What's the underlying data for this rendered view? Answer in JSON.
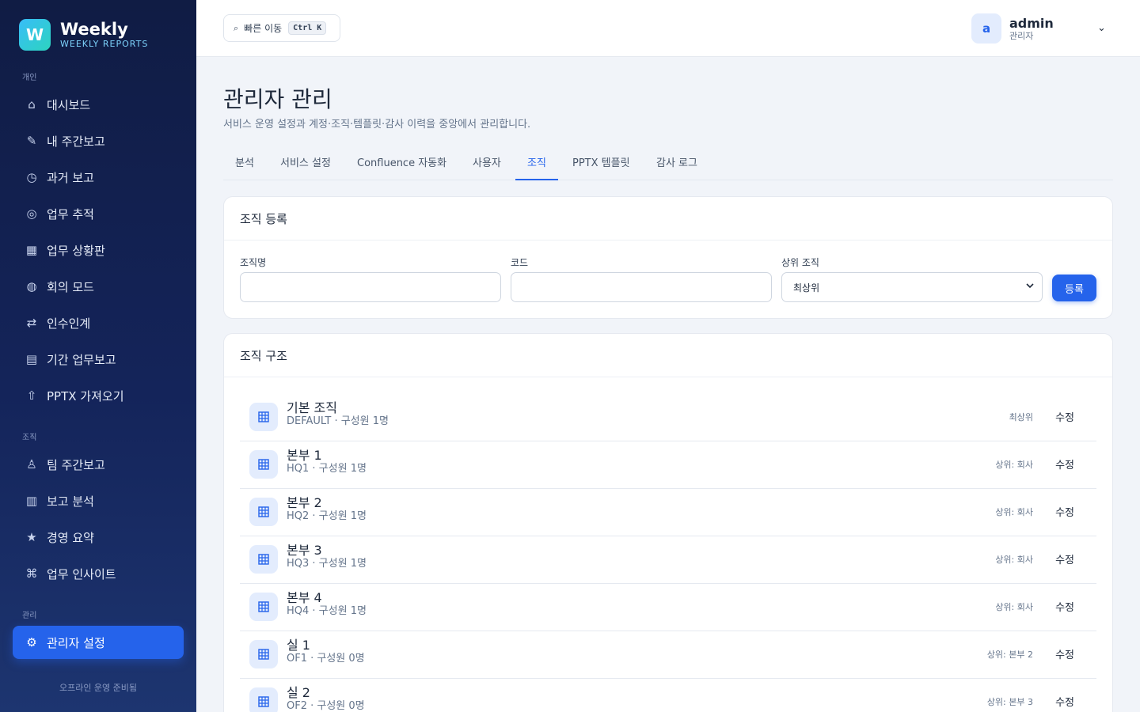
{
  "brand": {
    "logo_letter": "W",
    "name": "Weekly",
    "subtitle": "WEEKLY REPORTS"
  },
  "sidebar": {
    "sections": [
      {
        "label": "개인",
        "items": [
          {
            "icon": "home-icon",
            "glyph": "⌂",
            "label": "대시보드"
          },
          {
            "icon": "pencil-icon",
            "glyph": "✎",
            "label": "내 주간보고"
          },
          {
            "icon": "clock-icon",
            "glyph": "◷",
            "label": "과거 보고"
          },
          {
            "icon": "target-icon",
            "glyph": "◎",
            "label": "업무 추적"
          },
          {
            "icon": "grid-icon",
            "glyph": "▦",
            "label": "업무 상황판"
          },
          {
            "icon": "globe-icon",
            "glyph": "◍",
            "label": "회의 모드"
          },
          {
            "icon": "swap-icon",
            "glyph": "⇄",
            "label": "인수인계"
          },
          {
            "icon": "list-icon",
            "glyph": "▤",
            "label": "기간 업무보고"
          },
          {
            "icon": "upload-icon",
            "glyph": "⇧",
            "label": "PPTX 가져오기"
          }
        ]
      },
      {
        "label": "조직",
        "items": [
          {
            "icon": "team-icon",
            "glyph": "♙",
            "label": "팀 주간보고"
          },
          {
            "icon": "bar-chart-icon",
            "glyph": "▥",
            "label": "보고 분석"
          },
          {
            "icon": "star-icon",
            "glyph": "★",
            "label": "경영 요약"
          },
          {
            "icon": "command-icon",
            "glyph": "⌘",
            "label": "업무 인사이트"
          }
        ]
      },
      {
        "label": "관리",
        "items": [
          {
            "icon": "gear-icon",
            "glyph": "⚙",
            "label": "관리자 설정"
          }
        ]
      }
    ],
    "footer": "오프라인 운영 준비됨"
  },
  "header": {
    "quick_nav": {
      "icon": "search-icon",
      "glyph": "⌕",
      "label": "빠른 이동",
      "shortcut": "Ctrl K"
    },
    "user": {
      "initial": "a",
      "name": "admin",
      "role": "관리자",
      "chevron_glyph": "⌄"
    }
  },
  "page": {
    "title": "관리자 관리",
    "description": "서비스 운영 설정과 계정·조직·템플릿·감사 이력을 중앙에서 관리합니다.",
    "tabs": [
      "분석",
      "서비스 설정",
      "Confluence 자동화",
      "사용자",
      "조직",
      "PPTX 템플릿",
      "감사 로그"
    ],
    "active_tab": "조직"
  },
  "org_form": {
    "title": "조직 등록",
    "name_label": "조직명",
    "name_value": "",
    "code_label": "코드",
    "code_value": "",
    "parent_label": "상위 조직",
    "parent_value": "최상위",
    "submit_label": "등록"
  },
  "org_tree": {
    "title": "조직 구조",
    "rows": [
      {
        "name": "기본 조직",
        "meta": "DEFAULT · 구성원 1명",
        "parent": "최상위",
        "edit": "수정"
      },
      {
        "name": "본부 1",
        "meta": "HQ1 · 구성원 1명",
        "parent": "상위: 회사",
        "edit": "수정"
      },
      {
        "name": "본부 2",
        "meta": "HQ2 · 구성원 1명",
        "parent": "상위: 회사",
        "edit": "수정"
      },
      {
        "name": "본부 3",
        "meta": "HQ3 · 구성원 1명",
        "parent": "상위: 회사",
        "edit": "수정"
      },
      {
        "name": "본부 4",
        "meta": "HQ4 · 구성원 1명",
        "parent": "상위: 회사",
        "edit": "수정"
      },
      {
        "name": "실 1",
        "meta": "OF1 · 구성원 0명",
        "parent": "상위: 본부 2",
        "edit": "수정"
      },
      {
        "name": "실 2",
        "meta": "OF2 · 구성원 0명",
        "parent": "상위: 본부 3",
        "edit": "수정"
      }
    ]
  },
  "colors": {
    "accent": "#2563eb",
    "sidebar": "#14245a",
    "background": "#f1f4f9"
  }
}
